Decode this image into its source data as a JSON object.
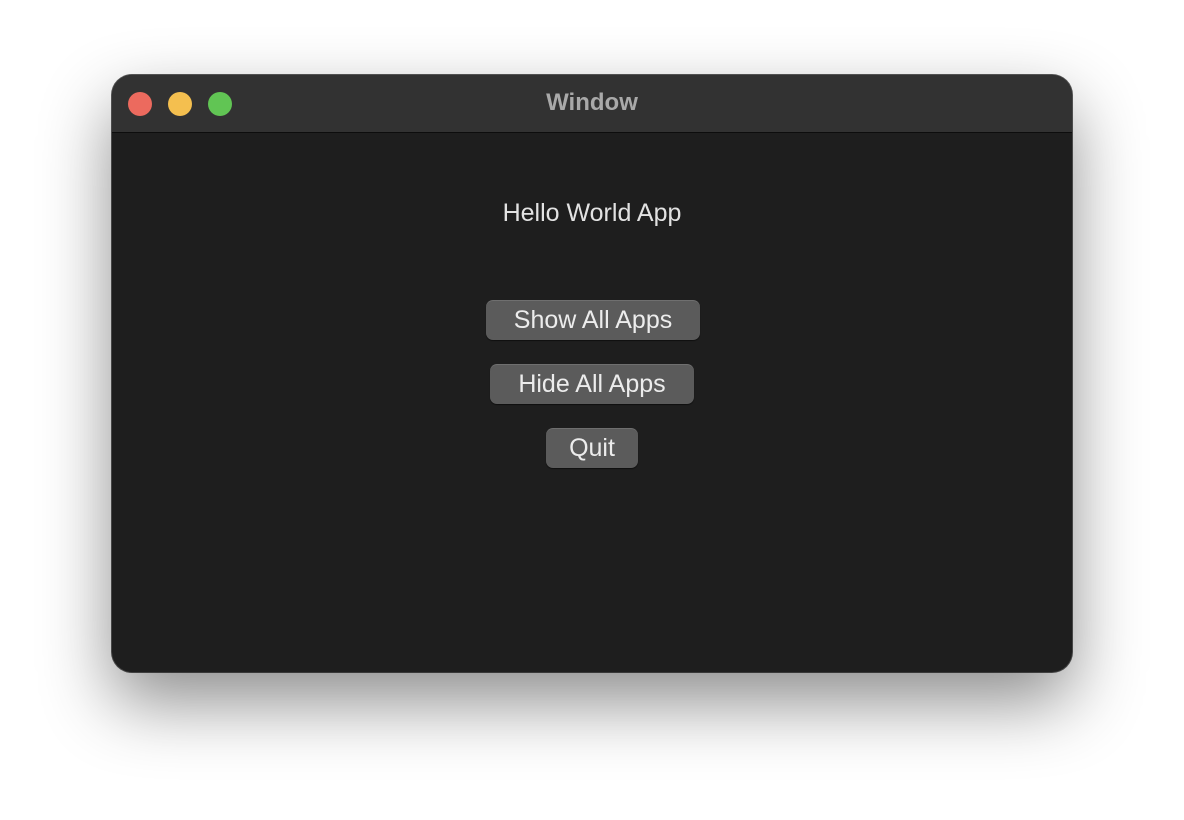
{
  "window": {
    "title": "Window",
    "traffic_lights": {
      "close_color": "#ec6a5e",
      "minimize_color": "#f4bf4f",
      "zoom_color": "#61c554"
    }
  },
  "content": {
    "label": "Hello World App",
    "buttons": {
      "show_all": "Show All Apps",
      "hide_all": "Hide All Apps",
      "quit": "Quit"
    }
  },
  "colors": {
    "window_background": "#1e1e1e",
    "titlebar_background": "#323232",
    "button_background": "#5b5b5b"
  }
}
